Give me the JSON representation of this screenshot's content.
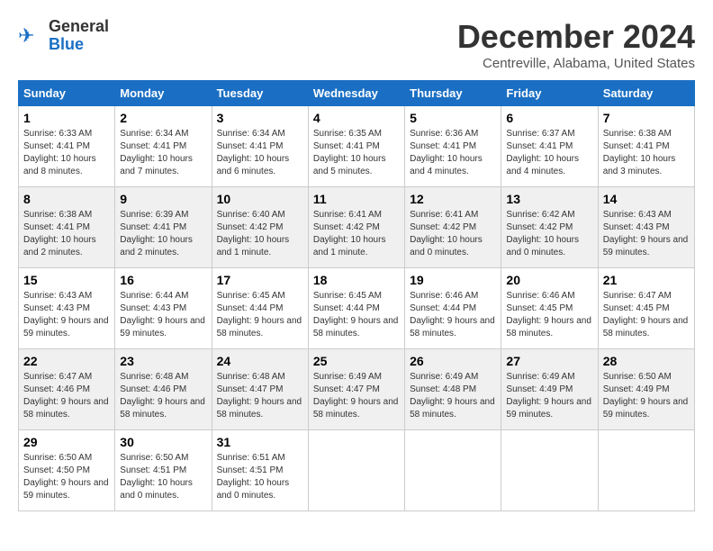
{
  "logo": {
    "general": "General",
    "blue": "Blue"
  },
  "title": "December 2024",
  "location": "Centreville, Alabama, United States",
  "weekdays": [
    "Sunday",
    "Monday",
    "Tuesday",
    "Wednesday",
    "Thursday",
    "Friday",
    "Saturday"
  ],
  "weeks": [
    [
      {
        "day": "1",
        "sunrise": "6:33 AM",
        "sunset": "4:41 PM",
        "daylight": "10 hours and 8 minutes."
      },
      {
        "day": "2",
        "sunrise": "6:34 AM",
        "sunset": "4:41 PM",
        "daylight": "10 hours and 7 minutes."
      },
      {
        "day": "3",
        "sunrise": "6:34 AM",
        "sunset": "4:41 PM",
        "daylight": "10 hours and 6 minutes."
      },
      {
        "day": "4",
        "sunrise": "6:35 AM",
        "sunset": "4:41 PM",
        "daylight": "10 hours and 5 minutes."
      },
      {
        "day": "5",
        "sunrise": "6:36 AM",
        "sunset": "4:41 PM",
        "daylight": "10 hours and 4 minutes."
      },
      {
        "day": "6",
        "sunrise": "6:37 AM",
        "sunset": "4:41 PM",
        "daylight": "10 hours and 4 minutes."
      },
      {
        "day": "7",
        "sunrise": "6:38 AM",
        "sunset": "4:41 PM",
        "daylight": "10 hours and 3 minutes."
      }
    ],
    [
      {
        "day": "8",
        "sunrise": "6:38 AM",
        "sunset": "4:41 PM",
        "daylight": "10 hours and 2 minutes."
      },
      {
        "day": "9",
        "sunrise": "6:39 AM",
        "sunset": "4:41 PM",
        "daylight": "10 hours and 2 minutes."
      },
      {
        "day": "10",
        "sunrise": "6:40 AM",
        "sunset": "4:42 PM",
        "daylight": "10 hours and 1 minute."
      },
      {
        "day": "11",
        "sunrise": "6:41 AM",
        "sunset": "4:42 PM",
        "daylight": "10 hours and 1 minute."
      },
      {
        "day": "12",
        "sunrise": "6:41 AM",
        "sunset": "4:42 PM",
        "daylight": "10 hours and 0 minutes."
      },
      {
        "day": "13",
        "sunrise": "6:42 AM",
        "sunset": "4:42 PM",
        "daylight": "10 hours and 0 minutes."
      },
      {
        "day": "14",
        "sunrise": "6:43 AM",
        "sunset": "4:43 PM",
        "daylight": "9 hours and 59 minutes."
      }
    ],
    [
      {
        "day": "15",
        "sunrise": "6:43 AM",
        "sunset": "4:43 PM",
        "daylight": "9 hours and 59 minutes."
      },
      {
        "day": "16",
        "sunrise": "6:44 AM",
        "sunset": "4:43 PM",
        "daylight": "9 hours and 59 minutes."
      },
      {
        "day": "17",
        "sunrise": "6:45 AM",
        "sunset": "4:44 PM",
        "daylight": "9 hours and 58 minutes."
      },
      {
        "day": "18",
        "sunrise": "6:45 AM",
        "sunset": "4:44 PM",
        "daylight": "9 hours and 58 minutes."
      },
      {
        "day": "19",
        "sunrise": "6:46 AM",
        "sunset": "4:44 PM",
        "daylight": "9 hours and 58 minutes."
      },
      {
        "day": "20",
        "sunrise": "6:46 AM",
        "sunset": "4:45 PM",
        "daylight": "9 hours and 58 minutes."
      },
      {
        "day": "21",
        "sunrise": "6:47 AM",
        "sunset": "4:45 PM",
        "daylight": "9 hours and 58 minutes."
      }
    ],
    [
      {
        "day": "22",
        "sunrise": "6:47 AM",
        "sunset": "4:46 PM",
        "daylight": "9 hours and 58 minutes."
      },
      {
        "day": "23",
        "sunrise": "6:48 AM",
        "sunset": "4:46 PM",
        "daylight": "9 hours and 58 minutes."
      },
      {
        "day": "24",
        "sunrise": "6:48 AM",
        "sunset": "4:47 PM",
        "daylight": "9 hours and 58 minutes."
      },
      {
        "day": "25",
        "sunrise": "6:49 AM",
        "sunset": "4:47 PM",
        "daylight": "9 hours and 58 minutes."
      },
      {
        "day": "26",
        "sunrise": "6:49 AM",
        "sunset": "4:48 PM",
        "daylight": "9 hours and 58 minutes."
      },
      {
        "day": "27",
        "sunrise": "6:49 AM",
        "sunset": "4:49 PM",
        "daylight": "9 hours and 59 minutes."
      },
      {
        "day": "28",
        "sunrise": "6:50 AM",
        "sunset": "4:49 PM",
        "daylight": "9 hours and 59 minutes."
      }
    ],
    [
      {
        "day": "29",
        "sunrise": "6:50 AM",
        "sunset": "4:50 PM",
        "daylight": "9 hours and 59 minutes."
      },
      {
        "day": "30",
        "sunrise": "6:50 AM",
        "sunset": "4:51 PM",
        "daylight": "10 hours and 0 minutes."
      },
      {
        "day": "31",
        "sunrise": "6:51 AM",
        "sunset": "4:51 PM",
        "daylight": "10 hours and 0 minutes."
      },
      null,
      null,
      null,
      null
    ]
  ]
}
